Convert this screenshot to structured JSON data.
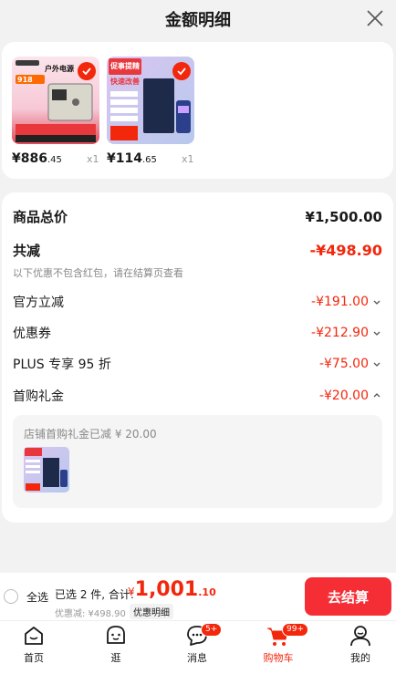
{
  "header": {
    "title": "金额明细"
  },
  "products": [
    {
      "price_int": "¥886",
      "price_dec": ".45",
      "qty": "x1",
      "thumb_text": "户外电源",
      "thumb_sub": "918"
    },
    {
      "price_int": "¥114",
      "price_dec": ".65",
      "qty": "x1",
      "thumb_text": "促事提精",
      "thumb_sub": "快速改善"
    }
  ],
  "summary": {
    "total_label": "商品总价",
    "total_value": "¥1,500.00",
    "reduce_label": "共减",
    "reduce_value": "-¥498.90",
    "reduce_note": "以下优惠不包含红包，请在结算页查看",
    "items": [
      {
        "label": "官方立减",
        "value": "-¥191.00",
        "chevron": "chevron-down-icon"
      },
      {
        "label": "优惠券",
        "value": "-¥212.90",
        "chevron": "chevron-down-icon"
      },
      {
        "label": "PLUS 专享 95 折",
        "value": "-¥75.00",
        "chevron": "chevron-down-icon"
      },
      {
        "label": "首购礼金",
        "value": "-¥20.00",
        "chevron": "chevron-up-icon"
      }
    ],
    "detail_text": "店铺首购礼金已减 ¥ 20.00"
  },
  "checkout": {
    "select_all": "全选",
    "selected_text": "已选 2 件, 合计:",
    "currency": "¥",
    "total_int": "1,001",
    "total_dec": ".10",
    "discount_text": "优惠减: ¥498.90",
    "detail_link": "优惠明细",
    "pay_button": "去结算"
  },
  "tabbar": [
    {
      "label": "首页",
      "icon": "home-icon"
    },
    {
      "label": "逛",
      "icon": "face-icon"
    },
    {
      "label": "消息",
      "icon": "chat-icon",
      "badge": "5+"
    },
    {
      "label": "购物车",
      "icon": "cart-icon",
      "badge": "99+",
      "active": true
    },
    {
      "label": "我的",
      "icon": "user-icon"
    }
  ],
  "colors": {
    "accent": "#f2270c",
    "pay_button": "#f52e35"
  }
}
